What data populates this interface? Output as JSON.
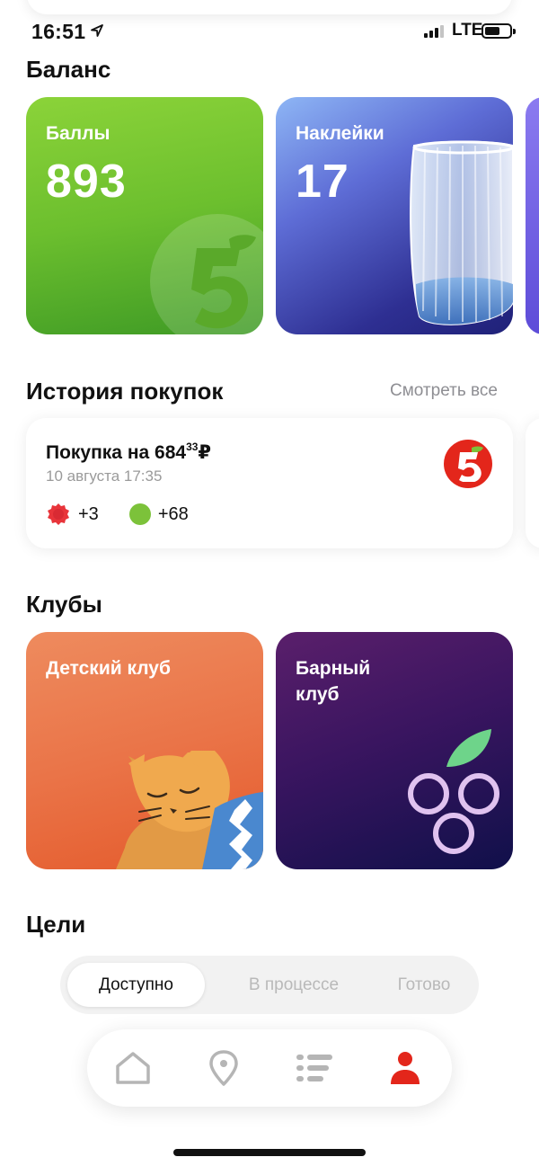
{
  "status_bar": {
    "time": "16:51",
    "network": "LTE",
    "location_icon": "location-arrow-icon",
    "signal_icon": "cell-signal-icon",
    "battery_icon": "battery-icon"
  },
  "balance": {
    "title": "Баланс",
    "points": {
      "label": "Баллы",
      "value": "893",
      "icon": "five-logo-icon",
      "color": "#6cbf2e"
    },
    "stickers": {
      "label": "Наклейки",
      "value": "17",
      "image": "glass-image",
      "color": "#2e2f92"
    }
  },
  "history": {
    "title": "История покупок",
    "see_all": "Смотреть все",
    "purchase": {
      "title_prefix": "Покупка на 684",
      "cents": "33",
      "currency": "₽",
      "date": "10 августа 17:35",
      "stickers_bonus": "+3",
      "points_bonus": "+68",
      "store_icon": "pyaterochka-logo-icon",
      "store_color": "#e3261b"
    }
  },
  "clubs": {
    "title": "Клубы",
    "kids": {
      "label": "Детский клуб",
      "image": "sleeping-cat-illustration",
      "color": "#ea7448"
    },
    "bar": {
      "label_line1": "Барный",
      "label_line2": "клуб",
      "image": "grapes-illustration",
      "color": "#3a1560"
    }
  },
  "goals": {
    "title": "Цели",
    "tabs": [
      {
        "label": "Доступно",
        "active": true
      },
      {
        "label": "В процессе",
        "active": false
      },
      {
        "label": "Готово",
        "active": false
      }
    ]
  },
  "tabbar": {
    "items": [
      {
        "icon": "home-icon",
        "active": false
      },
      {
        "icon": "map-pin-icon",
        "active": false
      },
      {
        "icon": "list-icon",
        "active": false
      },
      {
        "icon": "profile-icon",
        "active": true
      }
    ],
    "active_color": "#e3261b",
    "inactive_color": "#b5b5b5"
  }
}
